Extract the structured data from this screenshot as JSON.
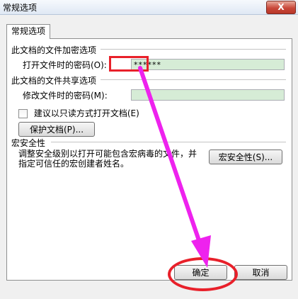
{
  "dialog": {
    "title": "常规选项",
    "close_label": "X"
  },
  "tab": {
    "label": "常规选项"
  },
  "encrypt": {
    "section_title": "此文档的文件加密选项",
    "open_password_label": "打开文件时的密码(O):",
    "open_password_value": "******"
  },
  "share": {
    "section_title": "此文档的文件共享选项",
    "modify_password_label": "修改文件时的密码(M):",
    "modify_password_value": "",
    "readonly_label": "建议以只读方式打开文档(E)",
    "protect_button": "保护文档(P)..."
  },
  "macro": {
    "section_title": "宏安全性",
    "description": "调整安全级别以打开可能包含宏病毒的文件，并指定可信任的宏创建者姓名。",
    "button": "宏安全性(S)..."
  },
  "footer": {
    "ok_label": "确定",
    "cancel_label": "取消"
  },
  "colors": {
    "annotation": "#e8202a",
    "arrow": "#ee22ee",
    "field_fill": "#d6ecd6"
  }
}
